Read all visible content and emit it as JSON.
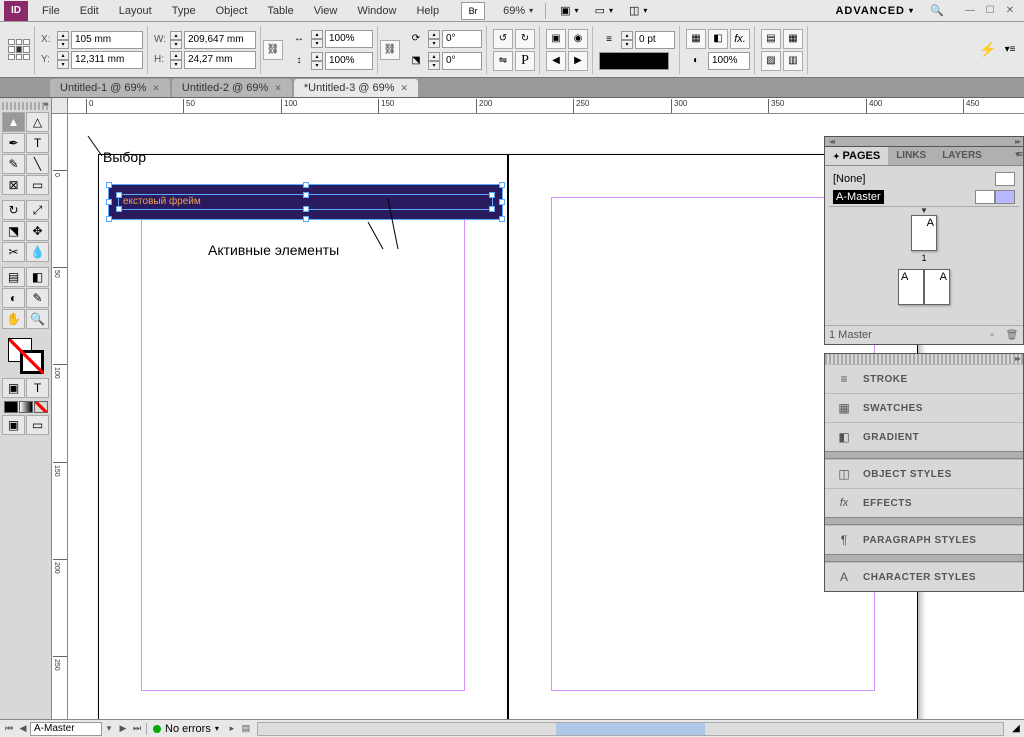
{
  "app": {
    "icon_text": "ID"
  },
  "menubar": {
    "items": [
      "File",
      "Edit",
      "Layout",
      "Type",
      "Object",
      "Table",
      "View",
      "Window",
      "Help"
    ],
    "br_icon": "Br",
    "zoom": "69%",
    "workspace": "ADVANCED"
  },
  "controlbar": {
    "x": "105 mm",
    "y": "12,311 mm",
    "w": "209,647 mm",
    "h": "24,27 mm",
    "scale_x": "100%",
    "scale_y": "100%",
    "rotate": "0°",
    "shear": "0°",
    "stroke_pt": "0 pt",
    "opacity": "100%"
  },
  "tabs": [
    {
      "label": "Untitled-1 @ 69%",
      "active": false
    },
    {
      "label": "Untitled-2 @ 69%",
      "active": false
    },
    {
      "label": "*Untitled-3 @ 69%",
      "active": true
    }
  ],
  "ruler_h": [
    "0",
    "50",
    "100",
    "150",
    "200",
    "250",
    "300",
    "350",
    "400",
    "450"
  ],
  "ruler_v": [
    "0",
    "50",
    "100",
    "150",
    "200",
    "250"
  ],
  "canvas": {
    "text_frame_content": "екстовый фрейм",
    "annotation_selection": "Выбор",
    "annotation_active": "Активные элементы"
  },
  "panels": {
    "pages": {
      "tabs": [
        "PAGES",
        "LINKS",
        "LAYERS"
      ],
      "masters": [
        {
          "name": "[None]",
          "active": false
        },
        {
          "name": "A-Master",
          "active": true
        }
      ],
      "page_label": "1",
      "spread_letter": "A",
      "footer": "1 Master"
    },
    "collapsed_group1": [
      "STROKE",
      "SWATCHES",
      "GRADIENT"
    ],
    "collapsed_group2": [
      "OBJECT STYLES",
      "EFFECTS"
    ],
    "collapsed_group3": [
      "PARAGRAPH STYLES"
    ],
    "collapsed_group4": [
      "CHARACTER STYLES"
    ]
  },
  "statusbar": {
    "page": "A-Master",
    "preflight": "No errors"
  }
}
